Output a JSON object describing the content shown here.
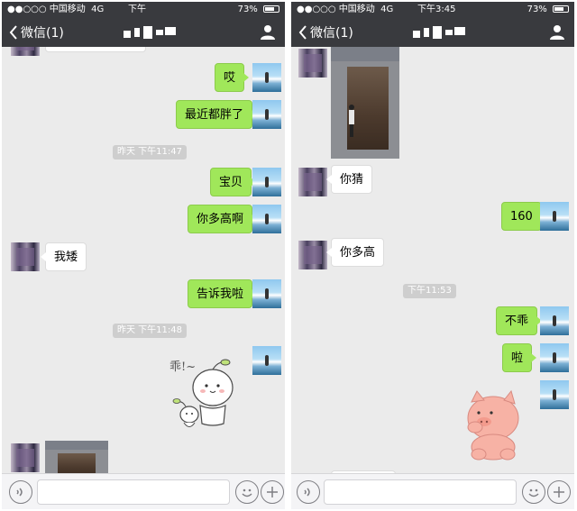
{
  "status_bar": {
    "carrier": "●●○○○ 中国移动",
    "network": "4G",
    "time_left": "下午",
    "time_right": "下午3:45",
    "battery": "73%",
    "battery_level": 0.73
  },
  "header": {
    "back_label": "微信(1)"
  },
  "left_chat": {
    "messages": {
      "m1": "哎",
      "m2": "最近都胖了",
      "ts1": "昨天 下午11:47",
      "m3": "宝贝",
      "m4": "你多高啊",
      "m5": "我矮",
      "m6": "告诉我啦",
      "ts2": "昨天 下午11:48"
    },
    "sticker_text": "乖!~"
  },
  "right_chat": {
    "messages": {
      "m1": "你猜",
      "m2": "160",
      "m3": "你多高",
      "ts1": "下午11:53",
      "m4": "不乖",
      "m5": "啦"
    }
  },
  "toolbar": {
    "voice_icon": "voice-icon",
    "emoji_icon": "emoji-icon",
    "plus_icon": "plus-icon"
  },
  "colors": {
    "header": "#393a3e",
    "chat_background": "#ebebeb",
    "my_bubble": "#a0e75a",
    "their_bubble": "#ffffff"
  }
}
